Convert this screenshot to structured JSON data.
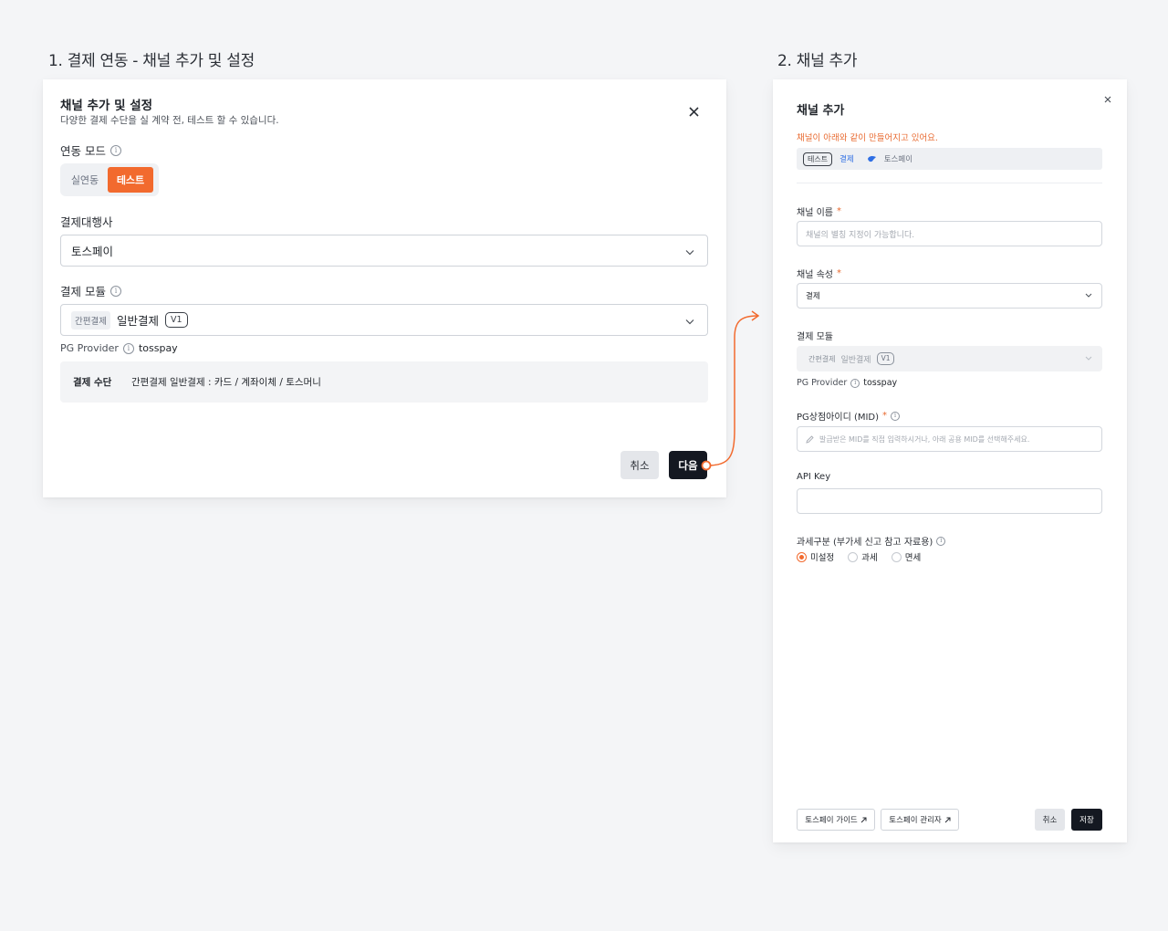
{
  "step1": {
    "title": "1. 결제 연동 - 채널 추가 및 설정",
    "dialog": {
      "title": "채널 추가 및 설정",
      "description": "다양한 결제 수단을 실 계약 전, 테스트 할 수 있습니다.",
      "mode_label": "연동 모드",
      "mode_options": [
        "실연동",
        "테스트"
      ],
      "mode_selected": "테스트",
      "pg_label": "결제대행사",
      "pg_value": "토스페이",
      "module_label": "결제 모듈",
      "module_tag": "간편결제",
      "module_value": "일반결제",
      "module_version": "V1",
      "provider_label": "PG Provider",
      "provider_value": "tosspay",
      "method_key": "결제 수단",
      "method_value": "간편결제 일반결제 : 카드 / 계좌이체 / 토스머니",
      "cancel_label": "취소",
      "next_label": "다음"
    }
  },
  "step2": {
    "title": "2. 채널 추가",
    "dialog": {
      "title": "채널 추가",
      "notice": "채널이 아래와 같이 만들어지고 있어요.",
      "preview": {
        "env": "테스트",
        "type": "결제",
        "pg": "토스페이"
      },
      "name_label": "채널 이름",
      "name_placeholder": "채널의 별칭 지정이 가능합니다.",
      "attr_label": "채널 속성",
      "attr_value": "결제",
      "module_label": "결제 모듈",
      "module_tag": "간편결제",
      "module_value": "일반결제",
      "module_version": "V1",
      "provider_label": "PG Provider",
      "provider_value": "tosspay",
      "mid_label": "PG상점아이디 (MID)",
      "mid_placeholder": "발급받은 MID를 직접 입력하시거나, 아래 공용 MID를 선택해주세요.",
      "apikey_label": "API Key",
      "apikey_value": "",
      "tax_label": "과세구분 (부가세 신고 참고 자료용)",
      "tax_options": [
        "미설정",
        "과세",
        "면세"
      ],
      "tax_selected": "미설정",
      "guide_label": "토스페이 가이드",
      "admin_label": "토스페이 관리자",
      "cancel_label": "취소",
      "save_label": "저장"
    }
  },
  "colors": {
    "accent": "#f26a2e",
    "dark_button": "#141821",
    "link_blue": "#2f6fe4"
  },
  "icons": [
    "close-icon",
    "info-icon",
    "chevron-down-icon",
    "pencil-icon",
    "external-link-icon",
    "tosspay-logo-icon"
  ]
}
